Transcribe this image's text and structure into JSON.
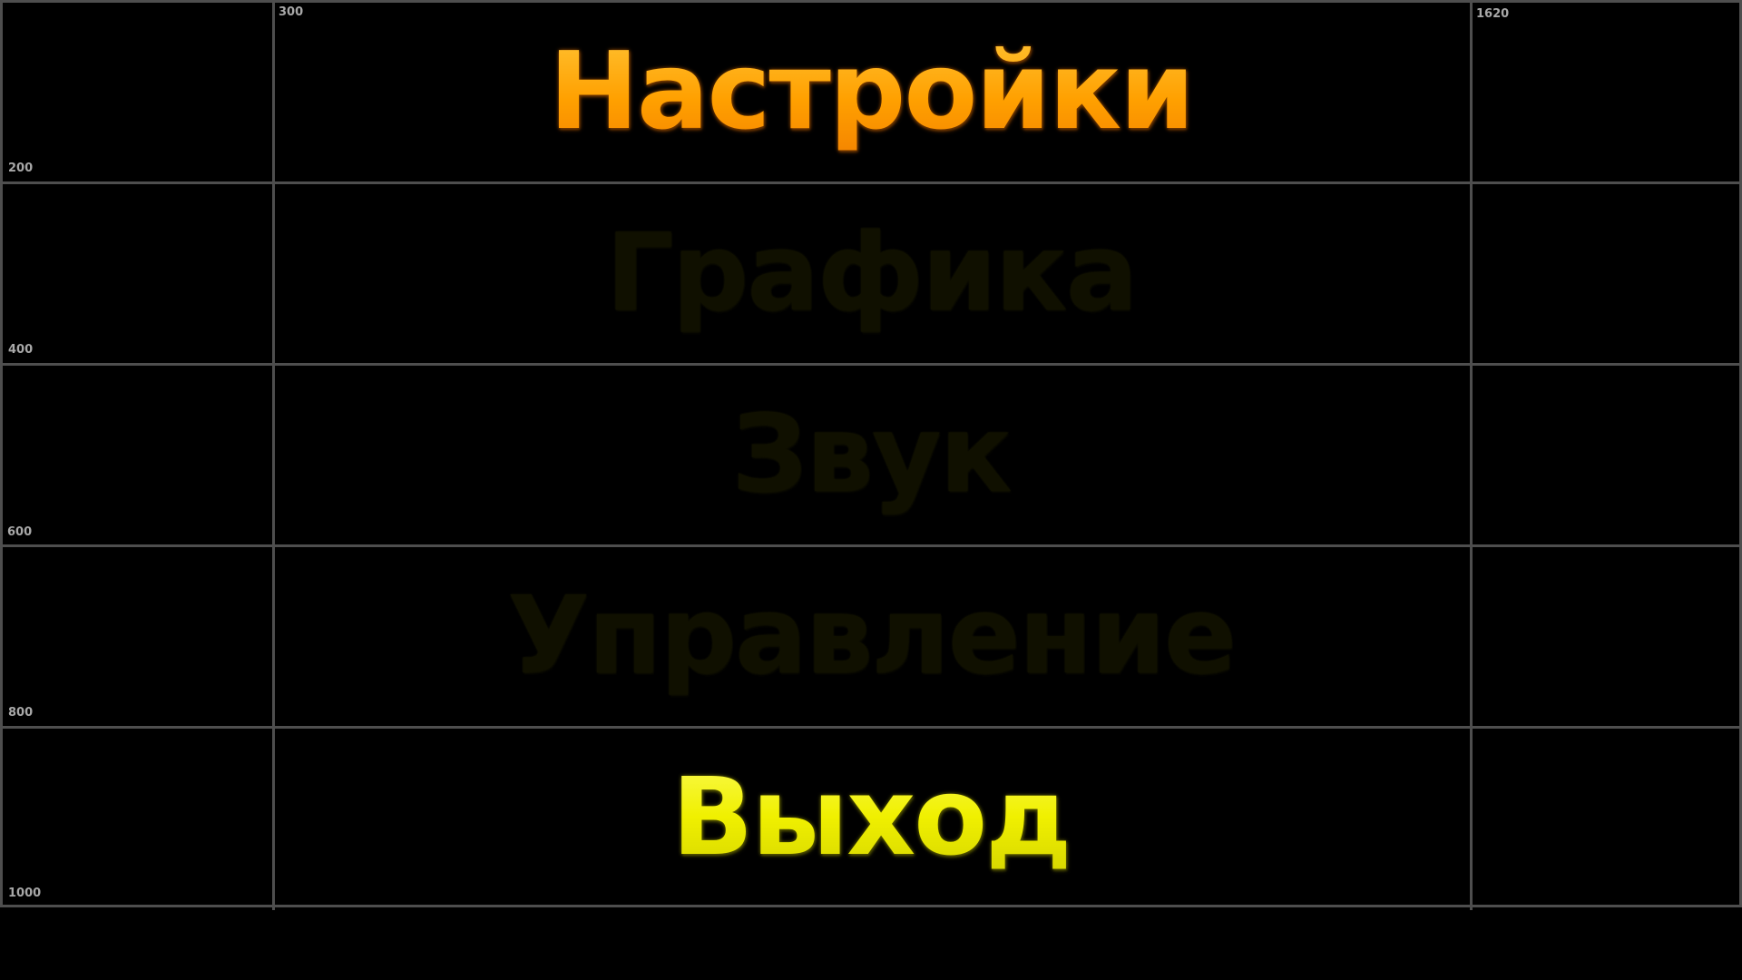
{
  "menu": {
    "title": "Настройки",
    "items": [
      {
        "label": "Графика",
        "state": "inactive"
      },
      {
        "label": "Звук",
        "state": "inactive"
      },
      {
        "label": "Управление",
        "state": "inactive"
      },
      {
        "label": "Выход",
        "state": "highlighted"
      }
    ]
  },
  "grid_labels": {
    "col_1": "300",
    "col_2": "1620",
    "row_1": "200",
    "row_2": "400",
    "row_3": "600",
    "row_4": "800",
    "row_5": "1000"
  },
  "colors": {
    "background": "#000000",
    "grid_lines": "#4e4e4e",
    "title": "#ff9f0a",
    "inactive_item": "#101000",
    "highlighted_item": "#f2f200"
  }
}
